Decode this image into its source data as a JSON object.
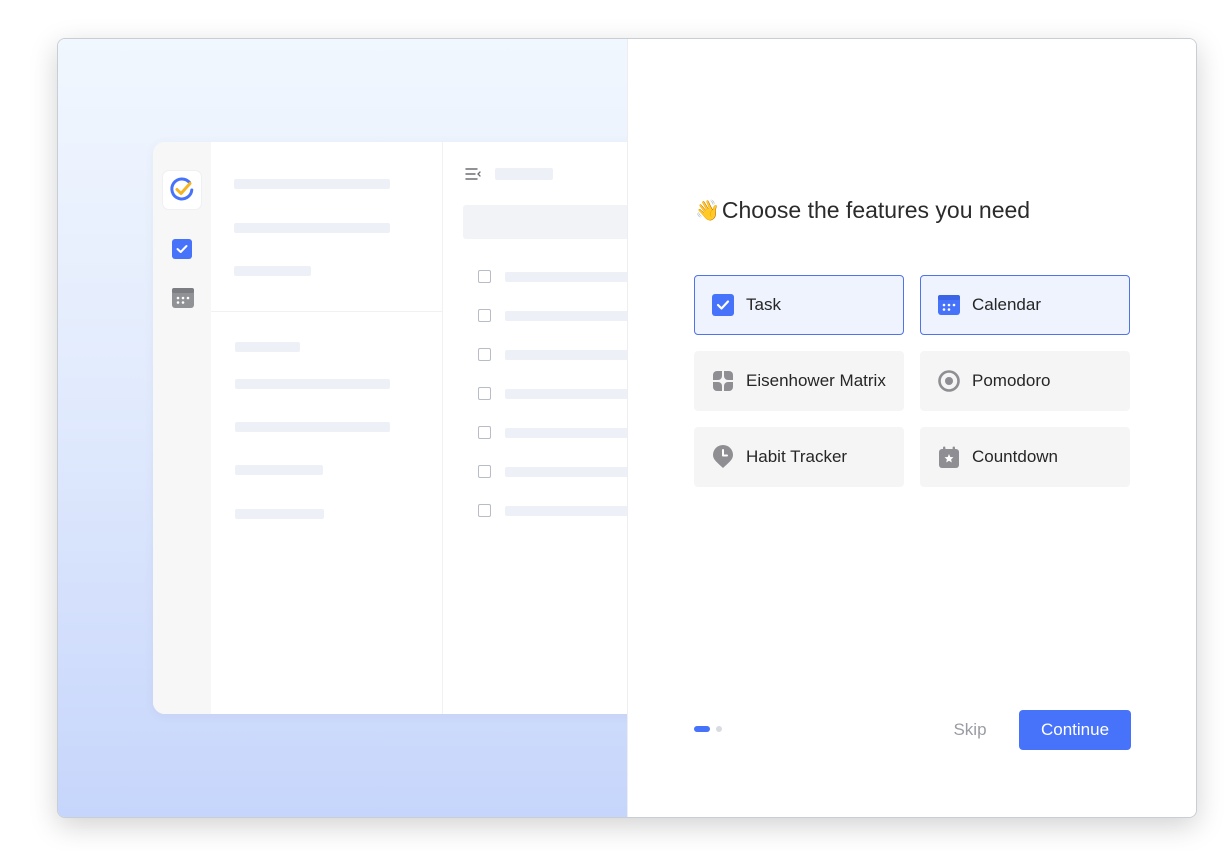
{
  "heading": {
    "emoji": "👋",
    "title": "Choose the features you need"
  },
  "features": [
    {
      "label": "Task",
      "selected": true,
      "icon": "checkbox-icon"
    },
    {
      "label": "Calendar",
      "selected": true,
      "icon": "calendar-icon"
    },
    {
      "label": "Eisenhower Matrix",
      "selected": false,
      "icon": "matrix-icon"
    },
    {
      "label": "Pomodoro",
      "selected": false,
      "icon": "pomodoro-icon"
    },
    {
      "label": "Habit Tracker",
      "selected": false,
      "icon": "habit-icon"
    },
    {
      "label": "Countdown",
      "selected": false,
      "icon": "countdown-icon"
    }
  ],
  "pagination": {
    "current": 1,
    "total": 2
  },
  "buttons": {
    "skip": "Skip",
    "continue": "Continue"
  },
  "colors": {
    "accent": "#4772fa",
    "selected_bg": "#eef3fd",
    "unselected_bg": "#f5f5f6",
    "icon_gray": "#8e8e93"
  }
}
